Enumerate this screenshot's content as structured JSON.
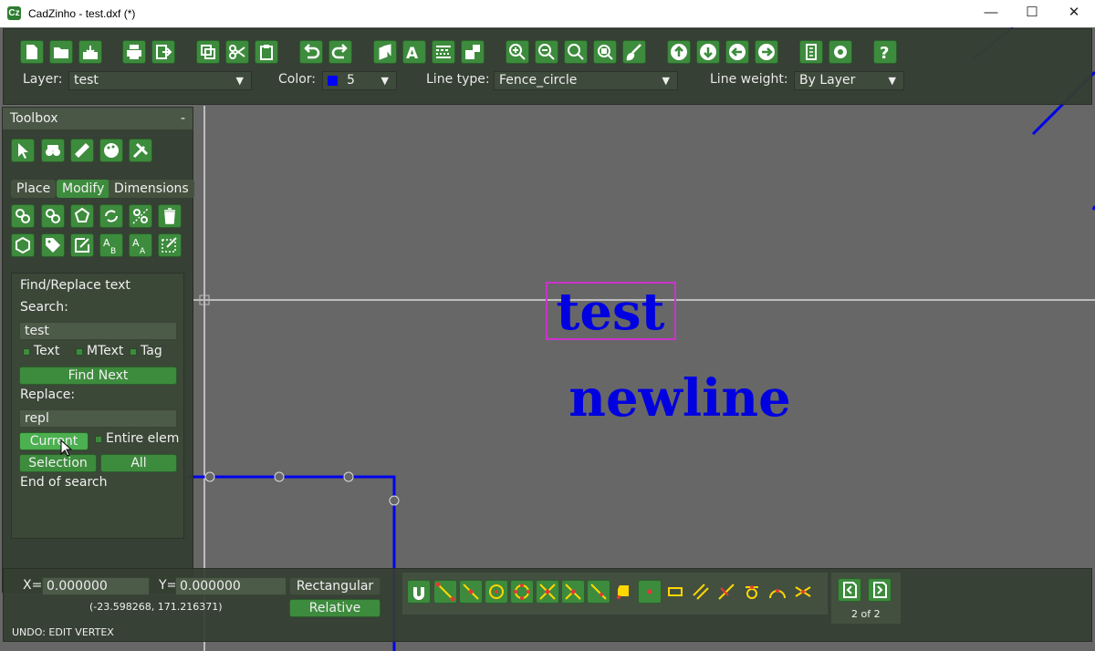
{
  "window": {
    "app_icon_letter": "Cz",
    "title": "CadZinho - test.dxf (*)",
    "minimize_glyph": "—",
    "maximize_glyph": "☐",
    "close_glyph": "✕"
  },
  "toolbar": {
    "icons": [
      "new-file-icon",
      "open-folder-icon",
      "save-icon",
      "print-icon",
      "export-icon",
      "copy-icon",
      "cut-icon",
      "paste-icon",
      "undo-icon",
      "redo-icon",
      "layers-icon",
      "text-style-icon",
      "line-types-icon",
      "blocks-icon",
      "zoom-in-icon",
      "zoom-out-icon",
      "zoom-all-icon",
      "zoom-window-icon",
      "brush-icon",
      "arrow-up-icon",
      "arrow-down-icon",
      "arrow-left-icon",
      "arrow-right-icon",
      "script-icon",
      "gear-icon",
      "help-icon"
    ],
    "layer_label": "Layer:",
    "layer_value": "test",
    "color_label": "Color:",
    "color_value": "5",
    "color_swatch": "#0000ff",
    "linetype_label": "Line type:",
    "linetype_value": "Fence_circle",
    "lineweight_label": "Line weight:",
    "lineweight_value": "By Layer",
    "dropdown_glyph": "▼"
  },
  "toolbox": {
    "title": "Toolbox",
    "minimize": "-",
    "top_icons": [
      "select-icon",
      "find-icon",
      "measure-icon",
      "palette-icon",
      "tools-icon"
    ],
    "tabs": [
      {
        "label": "Place",
        "active": false
      },
      {
        "label": "Modify",
        "active": true
      },
      {
        "label": "Dimensions",
        "active": false
      }
    ],
    "modify_icons_row1": [
      "move-icon",
      "duplicate-icon",
      "polygon-edit-icon",
      "rotate-icon",
      "mirror-icon",
      "delete-icon"
    ],
    "modify_icons_row2": [
      "explode-icon",
      "tag-icon",
      "edit-icon",
      "text-ab-icon",
      "text-aa-icon",
      "edit-attrib-icon"
    ]
  },
  "find_replace": {
    "title": "Find/Replace text",
    "search_label": "Search:",
    "search_value": "test",
    "opt_text": "Text",
    "opt_mtext": "MText",
    "opt_tag": "Tag",
    "find_next": "Find Next",
    "replace_label": "Replace:",
    "replace_value": "repl",
    "current_btn": "Current",
    "entire_elem": "Entire elem",
    "selection_btn": "Selection",
    "all_btn": "All",
    "status": "End of search"
  },
  "canvas": {
    "text1": "test",
    "text2": "newline",
    "text_color": "#0000e0",
    "highlight_color": "#cc33cc",
    "line_color": "#0000ee"
  },
  "bottom": {
    "x_label": "X=",
    "x_value": "0.000000",
    "y_label": "Y=",
    "y_value": "0.000000",
    "rect_btn": "Rectangular",
    "relative_btn": "Relative",
    "cursor_coords": "(-23.598268,  171.216371)",
    "undo_status": "UNDO: EDIT VERTEX",
    "snap_icons": [
      "magnet-icon",
      "snap-endpoint-icon",
      "snap-midpoint-icon",
      "snap-center-icon",
      "snap-quadrant-icon",
      "snap-intersection-icon",
      "snap-perpendicular-icon",
      "snap-nearest-icon",
      "snap-insertion-icon",
      "snap-node-icon",
      "snap-rectangle-icon",
      "snap-parallel-icon",
      "snap-extension-icon",
      "snap-tangent-icon",
      "snap-arc-icon",
      "snap-any-icon"
    ],
    "page_prev_icon": "page-prev-icon",
    "page_next_icon": "page-next-icon",
    "page_status": "2 of 2"
  }
}
